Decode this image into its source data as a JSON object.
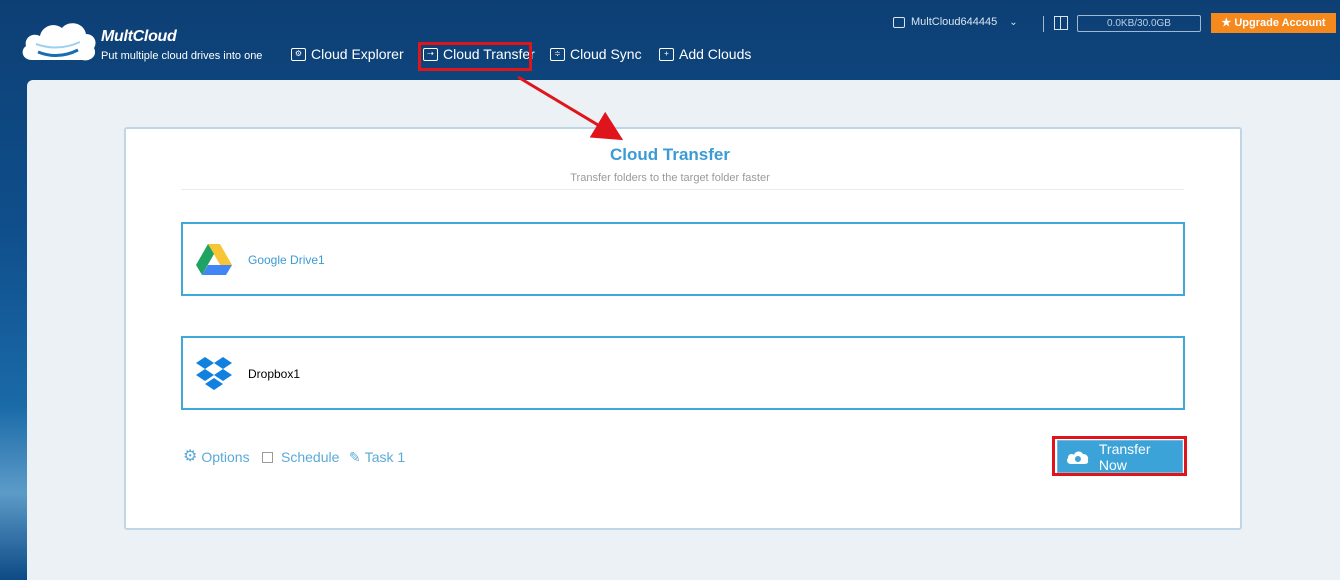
{
  "header": {
    "brand": "MultCloud",
    "tagline": "Put multiple cloud drives into one",
    "nav": [
      {
        "label": "Cloud Explorer",
        "icon": "gear-icon"
      },
      {
        "label": "Cloud Transfer",
        "icon": "transfer-icon"
      },
      {
        "label": "Cloud Sync",
        "icon": "sync-icon"
      },
      {
        "label": "Add Clouds",
        "icon": "plus-icon"
      }
    ],
    "username": "MultCloud644445",
    "storage": "0.0KB/30.0GB",
    "upgrade_label": "★ Upgrade Account"
  },
  "main": {
    "title": "Cloud Transfer",
    "subtitle": "Transfer folders to the target folder faster",
    "source": {
      "name": "Google Drive1",
      "icon": "google-drive-icon"
    },
    "target": {
      "name": "Dropbox1",
      "icon": "dropbox-icon"
    },
    "options_label": "Options",
    "schedule_label": "Schedule",
    "task_label": "Task 1",
    "transfer_button": "Transfer Now"
  },
  "colors": {
    "accent": "#3ba3d7",
    "highlight": "#e0151b",
    "upgrade": "#f5891d",
    "header_bg": "#0f4f8c"
  }
}
